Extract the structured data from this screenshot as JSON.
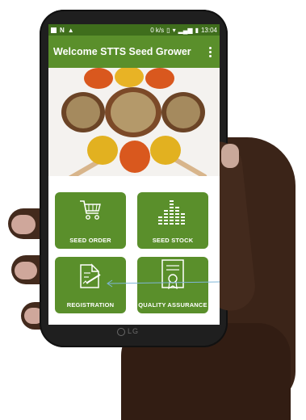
{
  "status_bar": {
    "speed": "0 k/s",
    "time": "13:04"
  },
  "app_bar": {
    "title": "Welcome STTS Seed Grower",
    "menu_icon": "overflow-menu-icon"
  },
  "tiles": [
    {
      "label": "SEED ORDER",
      "icon": "shopping-cart-icon"
    },
    {
      "label": "SEED STOCK",
      "icon": "bar-levels-icon"
    },
    {
      "label": "REGISTRATION",
      "icon": "edit-document-icon"
    },
    {
      "label": "QUALITY ASSURANCE",
      "icon": "certificate-icon"
    }
  ],
  "device": {
    "brand": "LG"
  },
  "colors": {
    "primary": "#5a8f2b",
    "status_bar": "#3f6e1c"
  }
}
